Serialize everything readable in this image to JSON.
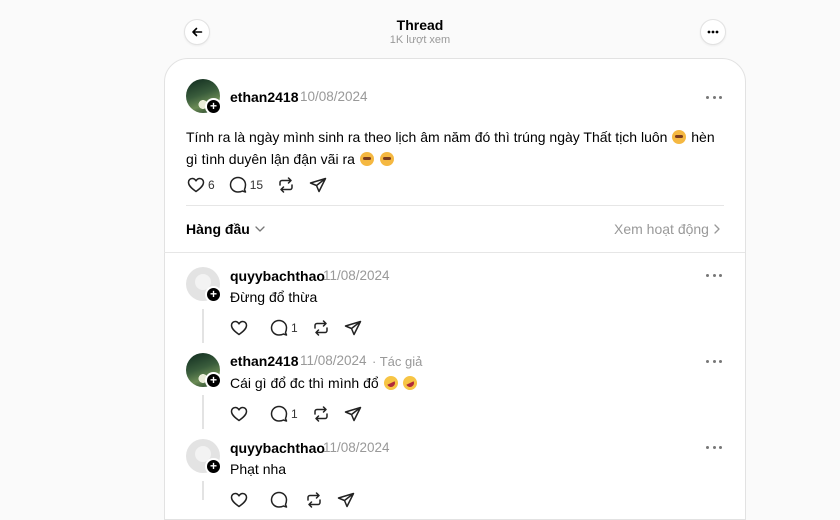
{
  "header": {
    "title": "Thread",
    "subtitle": "1K lượt xem"
  },
  "post": {
    "username": "ethan2418",
    "date": "10/08/2024",
    "text_part1": "Tính ra là ngày mình sinh ra theo lịch âm năm đó thì trúng ngày Thất tịch luôn",
    "text_part2": " hèn gì tình duyên lận đận vãi ra",
    "likes": "6",
    "comments": "15"
  },
  "sort": {
    "label": "Hàng đầu",
    "activity_label": "Xem hoạt động"
  },
  "replies": [
    {
      "username": "quyybachthao",
      "date": "11/08/2024",
      "author_tag": "",
      "text": "Đừng đổ thừa",
      "comments": "1"
    },
    {
      "username": "ethan2418",
      "date": "11/08/2024",
      "author_tag": "· Tác giả",
      "text": "Cái gì đổ đc thì mình đổ",
      "comments": "1"
    },
    {
      "username": "quyybachthao",
      "date": "11/08/2024",
      "author_tag": "",
      "text": "Phạt nha",
      "comments": ""
    }
  ]
}
